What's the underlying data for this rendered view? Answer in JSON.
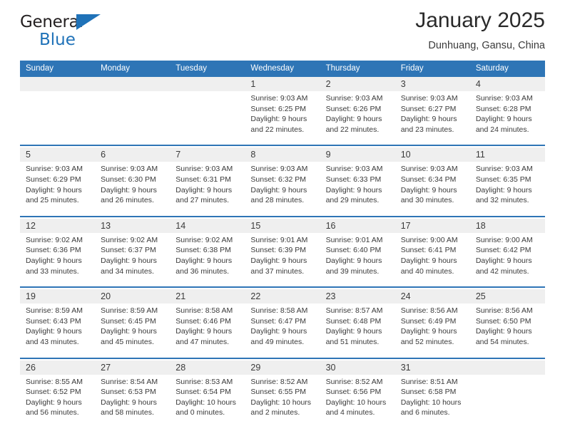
{
  "brand": {
    "line1": "General",
    "line2": "Blue",
    "triangle_color": "#1F72B8",
    "text_color": "#231F20"
  },
  "header": {
    "title": "January 2025",
    "location": "Dunhuang, Gansu, China"
  },
  "theme": {
    "header_blue": "#2E75B6",
    "daynum_band": "#EFEFEF",
    "text": "#3A3A3A",
    "page_background": "#FFFFFF"
  },
  "weekday_headers": [
    "Sunday",
    "Monday",
    "Tuesday",
    "Wednesday",
    "Thursday",
    "Friday",
    "Saturday"
  ],
  "weeks": [
    {
      "days": [
        {
          "num": "",
          "sunrise": "",
          "sunset": "",
          "daylight1": "",
          "daylight2": ""
        },
        {
          "num": "",
          "sunrise": "",
          "sunset": "",
          "daylight1": "",
          "daylight2": ""
        },
        {
          "num": "",
          "sunrise": "",
          "sunset": "",
          "daylight1": "",
          "daylight2": ""
        },
        {
          "num": "1",
          "sunrise": "Sunrise: 9:03 AM",
          "sunset": "Sunset: 6:25 PM",
          "daylight1": "Daylight: 9 hours",
          "daylight2": "and 22 minutes."
        },
        {
          "num": "2",
          "sunrise": "Sunrise: 9:03 AM",
          "sunset": "Sunset: 6:26 PM",
          "daylight1": "Daylight: 9 hours",
          "daylight2": "and 22 minutes."
        },
        {
          "num": "3",
          "sunrise": "Sunrise: 9:03 AM",
          "sunset": "Sunset: 6:27 PM",
          "daylight1": "Daylight: 9 hours",
          "daylight2": "and 23 minutes."
        },
        {
          "num": "4",
          "sunrise": "Sunrise: 9:03 AM",
          "sunset": "Sunset: 6:28 PM",
          "daylight1": "Daylight: 9 hours",
          "daylight2": "and 24 minutes."
        }
      ]
    },
    {
      "days": [
        {
          "num": "5",
          "sunrise": "Sunrise: 9:03 AM",
          "sunset": "Sunset: 6:29 PM",
          "daylight1": "Daylight: 9 hours",
          "daylight2": "and 25 minutes."
        },
        {
          "num": "6",
          "sunrise": "Sunrise: 9:03 AM",
          "sunset": "Sunset: 6:30 PM",
          "daylight1": "Daylight: 9 hours",
          "daylight2": "and 26 minutes."
        },
        {
          "num": "7",
          "sunrise": "Sunrise: 9:03 AM",
          "sunset": "Sunset: 6:31 PM",
          "daylight1": "Daylight: 9 hours",
          "daylight2": "and 27 minutes."
        },
        {
          "num": "8",
          "sunrise": "Sunrise: 9:03 AM",
          "sunset": "Sunset: 6:32 PM",
          "daylight1": "Daylight: 9 hours",
          "daylight2": "and 28 minutes."
        },
        {
          "num": "9",
          "sunrise": "Sunrise: 9:03 AM",
          "sunset": "Sunset: 6:33 PM",
          "daylight1": "Daylight: 9 hours",
          "daylight2": "and 29 minutes."
        },
        {
          "num": "10",
          "sunrise": "Sunrise: 9:03 AM",
          "sunset": "Sunset: 6:34 PM",
          "daylight1": "Daylight: 9 hours",
          "daylight2": "and 30 minutes."
        },
        {
          "num": "11",
          "sunrise": "Sunrise: 9:03 AM",
          "sunset": "Sunset: 6:35 PM",
          "daylight1": "Daylight: 9 hours",
          "daylight2": "and 32 minutes."
        }
      ]
    },
    {
      "days": [
        {
          "num": "12",
          "sunrise": "Sunrise: 9:02 AM",
          "sunset": "Sunset: 6:36 PM",
          "daylight1": "Daylight: 9 hours",
          "daylight2": "and 33 minutes."
        },
        {
          "num": "13",
          "sunrise": "Sunrise: 9:02 AM",
          "sunset": "Sunset: 6:37 PM",
          "daylight1": "Daylight: 9 hours",
          "daylight2": "and 34 minutes."
        },
        {
          "num": "14",
          "sunrise": "Sunrise: 9:02 AM",
          "sunset": "Sunset: 6:38 PM",
          "daylight1": "Daylight: 9 hours",
          "daylight2": "and 36 minutes."
        },
        {
          "num": "15",
          "sunrise": "Sunrise: 9:01 AM",
          "sunset": "Sunset: 6:39 PM",
          "daylight1": "Daylight: 9 hours",
          "daylight2": "and 37 minutes."
        },
        {
          "num": "16",
          "sunrise": "Sunrise: 9:01 AM",
          "sunset": "Sunset: 6:40 PM",
          "daylight1": "Daylight: 9 hours",
          "daylight2": "and 39 minutes."
        },
        {
          "num": "17",
          "sunrise": "Sunrise: 9:00 AM",
          "sunset": "Sunset: 6:41 PM",
          "daylight1": "Daylight: 9 hours",
          "daylight2": "and 40 minutes."
        },
        {
          "num": "18",
          "sunrise": "Sunrise: 9:00 AM",
          "sunset": "Sunset: 6:42 PM",
          "daylight1": "Daylight: 9 hours",
          "daylight2": "and 42 minutes."
        }
      ]
    },
    {
      "days": [
        {
          "num": "19",
          "sunrise": "Sunrise: 8:59 AM",
          "sunset": "Sunset: 6:43 PM",
          "daylight1": "Daylight: 9 hours",
          "daylight2": "and 43 minutes."
        },
        {
          "num": "20",
          "sunrise": "Sunrise: 8:59 AM",
          "sunset": "Sunset: 6:45 PM",
          "daylight1": "Daylight: 9 hours",
          "daylight2": "and 45 minutes."
        },
        {
          "num": "21",
          "sunrise": "Sunrise: 8:58 AM",
          "sunset": "Sunset: 6:46 PM",
          "daylight1": "Daylight: 9 hours",
          "daylight2": "and 47 minutes."
        },
        {
          "num": "22",
          "sunrise": "Sunrise: 8:58 AM",
          "sunset": "Sunset: 6:47 PM",
          "daylight1": "Daylight: 9 hours",
          "daylight2": "and 49 minutes."
        },
        {
          "num": "23",
          "sunrise": "Sunrise: 8:57 AM",
          "sunset": "Sunset: 6:48 PM",
          "daylight1": "Daylight: 9 hours",
          "daylight2": "and 51 minutes."
        },
        {
          "num": "24",
          "sunrise": "Sunrise: 8:56 AM",
          "sunset": "Sunset: 6:49 PM",
          "daylight1": "Daylight: 9 hours",
          "daylight2": "and 52 minutes."
        },
        {
          "num": "25",
          "sunrise": "Sunrise: 8:56 AM",
          "sunset": "Sunset: 6:50 PM",
          "daylight1": "Daylight: 9 hours",
          "daylight2": "and 54 minutes."
        }
      ]
    },
    {
      "days": [
        {
          "num": "26",
          "sunrise": "Sunrise: 8:55 AM",
          "sunset": "Sunset: 6:52 PM",
          "daylight1": "Daylight: 9 hours",
          "daylight2": "and 56 minutes."
        },
        {
          "num": "27",
          "sunrise": "Sunrise: 8:54 AM",
          "sunset": "Sunset: 6:53 PM",
          "daylight1": "Daylight: 9 hours",
          "daylight2": "and 58 minutes."
        },
        {
          "num": "28",
          "sunrise": "Sunrise: 8:53 AM",
          "sunset": "Sunset: 6:54 PM",
          "daylight1": "Daylight: 10 hours",
          "daylight2": "and 0 minutes."
        },
        {
          "num": "29",
          "sunrise": "Sunrise: 8:52 AM",
          "sunset": "Sunset: 6:55 PM",
          "daylight1": "Daylight: 10 hours",
          "daylight2": "and 2 minutes."
        },
        {
          "num": "30",
          "sunrise": "Sunrise: 8:52 AM",
          "sunset": "Sunset: 6:56 PM",
          "daylight1": "Daylight: 10 hours",
          "daylight2": "and 4 minutes."
        },
        {
          "num": "31",
          "sunrise": "Sunrise: 8:51 AM",
          "sunset": "Sunset: 6:58 PM",
          "daylight1": "Daylight: 10 hours",
          "daylight2": "and 6 minutes."
        },
        {
          "num": "",
          "sunrise": "",
          "sunset": "",
          "daylight1": "",
          "daylight2": ""
        }
      ]
    }
  ]
}
